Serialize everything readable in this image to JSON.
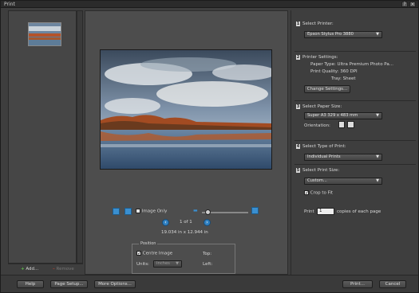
{
  "window": {
    "title": "Print"
  },
  "thumbnails": {
    "add_label": "Add...",
    "remove_label": "Remove"
  },
  "preview": {
    "image_only_label": "Image Only",
    "page_indicator": "1 of 1",
    "dimensions": "19.034 in x 12.944 in",
    "position": {
      "legend": "Position",
      "center_image_label": "Centre Image",
      "units_label": "Units:",
      "units_value": "Inches",
      "top_label": "Top:",
      "left_label": "Left:"
    }
  },
  "settings": {
    "printer": {
      "title": "Select Printer:",
      "value": "Epson Stylus Pro 3880"
    },
    "printer_settings": {
      "title": "Printer Settings:",
      "paper_type": "Paper Type: Ultra Premium Photo Pa...",
      "print_quality": "Print Quality: 360 DPI",
      "tray": "Tray: Sheet",
      "change_button": "Change Settings..."
    },
    "paper_size": {
      "title": "Select Paper Size:",
      "value": "Super A3 329 x 483 mm",
      "orientation_label": "Orientation:"
    },
    "print_type": {
      "title": "Select Type of Print:",
      "value": "Individual Prints"
    },
    "print_size": {
      "title": "Select Print Size:",
      "value": "Custom...",
      "crop_label": "Crop to Fit",
      "copies_prefix": "Print",
      "copies_value": "1",
      "copies_suffix": "copies of each page"
    }
  },
  "footer": {
    "help": "Help",
    "page_setup": "Page Setup...",
    "more_options": "More Options...",
    "print": "Print...",
    "cancel": "Cancel"
  }
}
